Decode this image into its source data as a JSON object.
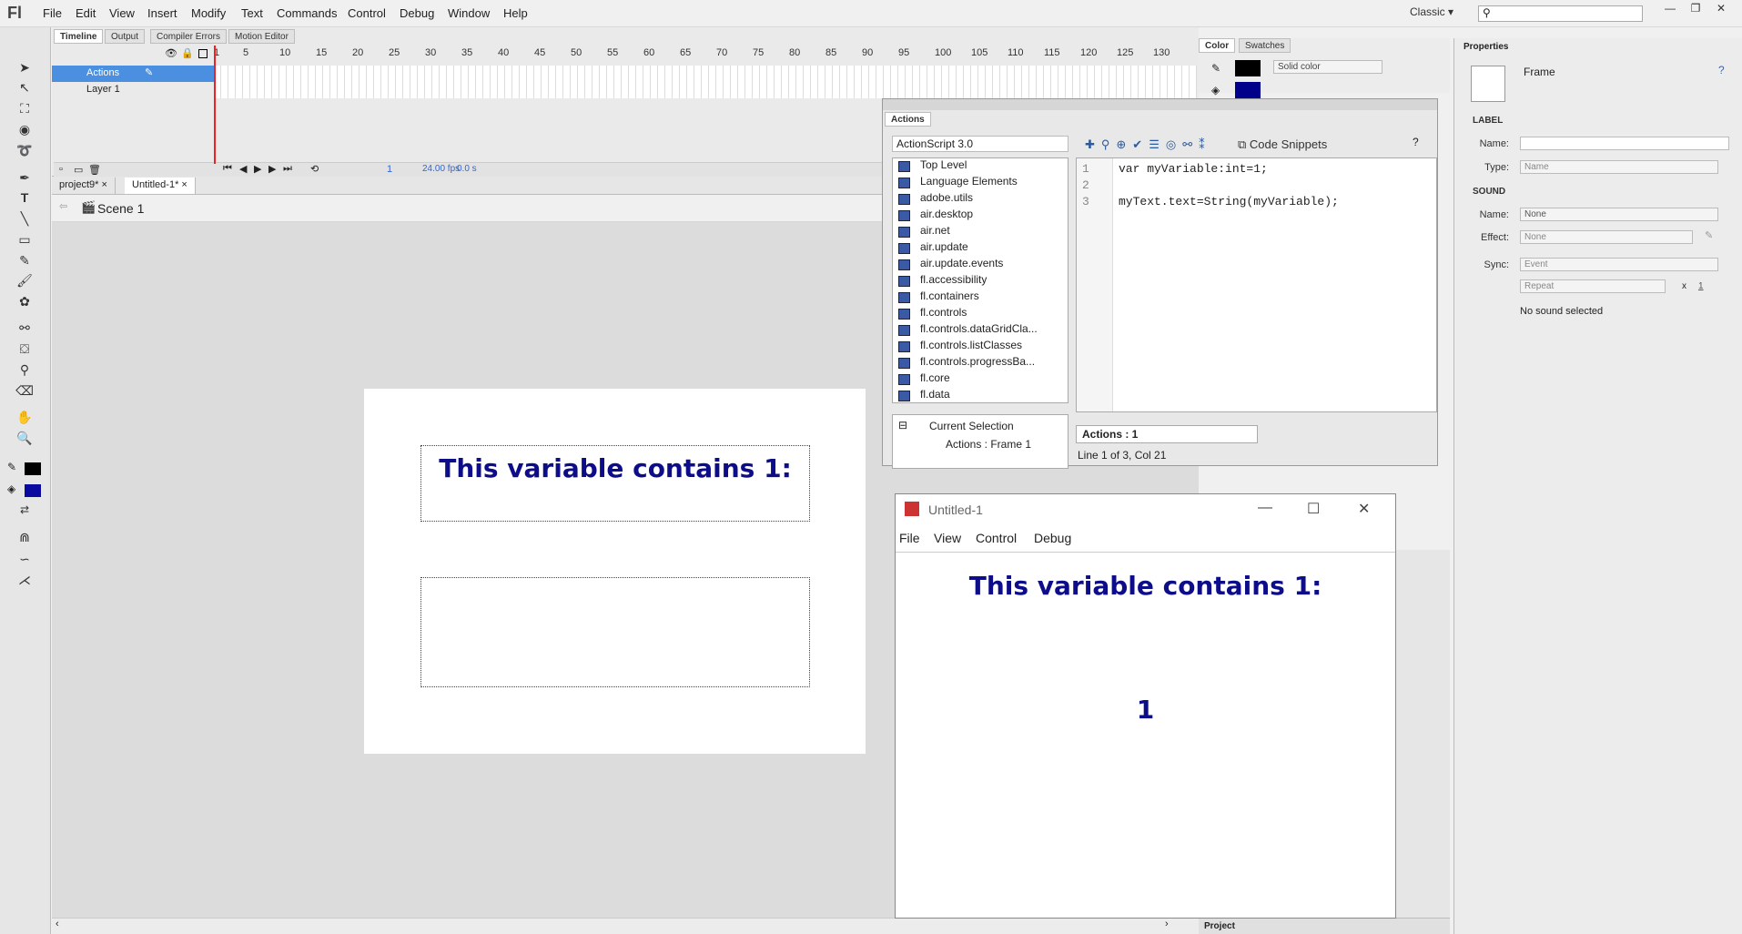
{
  "app": {
    "logo": "Fl",
    "workspace": "Classic",
    "workspace_arrow": "▾",
    "search_glyph": "⚲",
    "window_btns": [
      "—",
      "❐",
      "✕"
    ]
  },
  "menu": [
    "File",
    "Edit",
    "View",
    "Insert",
    "Modify",
    "Text",
    "Commands",
    "Control",
    "Debug",
    "Window",
    "Help"
  ],
  "timeline": {
    "tabs": [
      "Timeline",
      "Output",
      "Compiler Errors",
      "Motion Editor"
    ],
    "ruler": [
      "1",
      "5",
      "10",
      "15",
      "20",
      "25",
      "30",
      "35",
      "40",
      "45",
      "50",
      "55",
      "60",
      "65",
      "70",
      "75",
      "80",
      "85",
      "90",
      "95",
      "100",
      "105",
      "110",
      "115",
      "120",
      "125",
      "130"
    ],
    "layers": [
      {
        "name": "Actions"
      },
      {
        "name": "Layer 1"
      }
    ],
    "status": {
      "frame": "1",
      "fps": "24.00 fps",
      "time": "0.0 s"
    }
  },
  "doctabs": [
    "project9*",
    "Untitled-1*"
  ],
  "scene": "Scene 1",
  "stage": {
    "heading": "This variable contains 1:"
  },
  "color_panel": {
    "tabs": [
      "Color",
      "Swatches"
    ],
    "mode": "Solid color",
    "stroke": "#000000",
    "fill": "#00008b"
  },
  "properties": {
    "title": "Properties",
    "subtitle": "Frame",
    "label_section": "LABEL",
    "name_label": "Name:",
    "type_label": "Type:",
    "type_value": "Name",
    "sound_section": "SOUND",
    "sound_name_label": "Name:",
    "sound_name_value": "None",
    "effect_label": "Effect:",
    "effect_value": "None",
    "sync_label": "Sync:",
    "sync_value": "Event",
    "repeat_value": "Repeat",
    "repeat_x": "x",
    "repeat_count": "1",
    "no_sound": "No sound selected"
  },
  "actions": {
    "title": "Actions",
    "language": "ActionScript 3.0",
    "library": [
      "Top Level",
      "Language Elements",
      "adobe.utils",
      "air.desktop",
      "air.net",
      "air.update",
      "air.update.events",
      "fl.accessibility",
      "fl.containers",
      "fl.controls",
      "fl.controls.dataGridCla...",
      "fl.controls.listClasses",
      "fl.controls.progressBa...",
      "fl.core",
      "fl.data"
    ],
    "tree": {
      "root": "Current Selection",
      "child": "Actions : Frame 1"
    },
    "code_snippets": "Code Snippets",
    "lines": [
      {
        "num": "1",
        "text": "var myVariable:int=1;"
      },
      {
        "num": "2",
        "text": ""
      },
      {
        "num": "3",
        "text": "myText.text=String(myVariable);"
      }
    ],
    "frame_tab": "Actions : 1",
    "status": "Line 1 of 3, Col 21"
  },
  "swf": {
    "title": "Untitled-1",
    "menu": [
      "File",
      "View",
      "Control",
      "Debug"
    ],
    "heading": "This variable contains 1:",
    "value": "1"
  },
  "project_tab": "Project"
}
